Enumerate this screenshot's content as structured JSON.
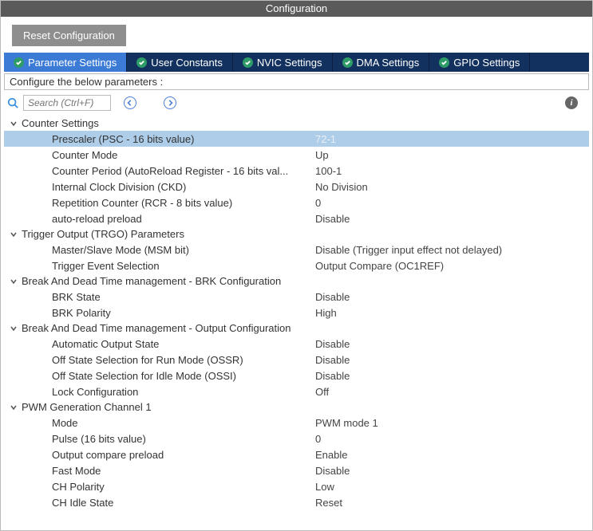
{
  "window": {
    "title": "Configuration"
  },
  "toolbar": {
    "reset_label": "Reset Configuration"
  },
  "tabs": [
    {
      "label": "Parameter Settings",
      "active": true
    },
    {
      "label": "User Constants",
      "active": false
    },
    {
      "label": "NVIC Settings",
      "active": false
    },
    {
      "label": "DMA Settings",
      "active": false
    },
    {
      "label": "GPIO Settings",
      "active": false
    }
  ],
  "configure_text": "Configure the below parameters :",
  "search": {
    "placeholder": "Search (Ctrl+F)"
  },
  "groups": [
    {
      "title": "Counter Settings",
      "rows": [
        {
          "label": "Prescaler (PSC - 16 bits value)",
          "value": "72-1",
          "selected": true
        },
        {
          "label": "Counter Mode",
          "value": "Up"
        },
        {
          "label": "Counter Period (AutoReload Register - 16 bits val...",
          "value": "100-1"
        },
        {
          "label": "Internal Clock Division (CKD)",
          "value": "No Division"
        },
        {
          "label": "Repetition Counter (RCR - 8 bits value)",
          "value": "0"
        },
        {
          "label": "auto-reload preload",
          "value": "Disable"
        }
      ]
    },
    {
      "title": "Trigger Output (TRGO) Parameters",
      "rows": [
        {
          "label": "Master/Slave Mode (MSM bit)",
          "value": "Disable (Trigger input effect not delayed)"
        },
        {
          "label": "Trigger Event Selection",
          "value": "Output Compare (OC1REF)"
        }
      ]
    },
    {
      "title": "Break And Dead Time management - BRK Configuration",
      "rows": [
        {
          "label": "BRK State",
          "value": "Disable"
        },
        {
          "label": "BRK Polarity",
          "value": "High"
        }
      ]
    },
    {
      "title": "Break And Dead Time management - Output Configuration",
      "rows": [
        {
          "label": "Automatic Output State",
          "value": "Disable"
        },
        {
          "label": "Off State Selection for Run Mode (OSSR)",
          "value": "Disable"
        },
        {
          "label": "Off State Selection for Idle Mode (OSSI)",
          "value": "Disable"
        },
        {
          "label": "Lock Configuration",
          "value": "Off"
        }
      ]
    },
    {
      "title": "PWM Generation Channel 1",
      "rows": [
        {
          "label": "Mode",
          "value": "PWM mode 1"
        },
        {
          "label": "Pulse (16 bits value)",
          "value": "0"
        },
        {
          "label": "Output compare preload",
          "value": "Enable"
        },
        {
          "label": "Fast Mode",
          "value": "Disable"
        },
        {
          "label": "CH Polarity",
          "value": "Low"
        },
        {
          "label": "CH Idle State",
          "value": "Reset"
        }
      ]
    }
  ]
}
